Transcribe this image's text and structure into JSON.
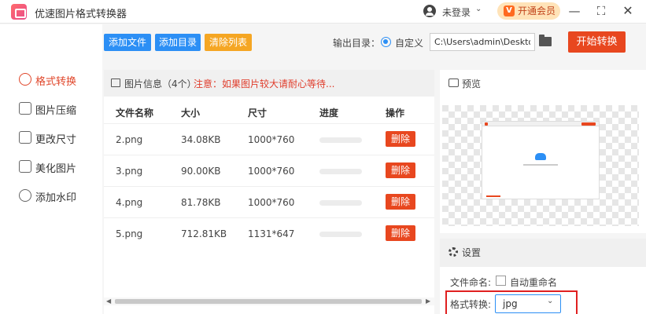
{
  "app": {
    "title": "优速图片格式转换器",
    "login": "未登录",
    "vip": "开通会员",
    "vip_icon": "V",
    "minimize": "—",
    "maximize": "⛶",
    "close": "✕"
  },
  "sidebar": {
    "items": [
      {
        "label": "格式转换",
        "icon": "format-convert-icon"
      },
      {
        "label": "图片压缩",
        "icon": "compress-icon"
      },
      {
        "label": "更改尺寸",
        "icon": "resize-icon"
      },
      {
        "label": "美化图片",
        "icon": "beautify-icon"
      },
      {
        "label": "添加水印",
        "icon": "watermark-icon"
      }
    ]
  },
  "toolbar": {
    "add_file": "添加文件",
    "add_dir": "添加目录",
    "clear_list": "清除列表",
    "output_dir_label": "输出目录：",
    "custom_label": "自定义",
    "output_path": "C:\\Users\\admin\\Desktop",
    "start": "开始转换"
  },
  "file_list": {
    "info_label": "图片信息（4个）",
    "info_warning": "注意：如果图片较大请耐心等待...",
    "columns": [
      "文件名称",
      "大小",
      "尺寸",
      "进度",
      "操作"
    ],
    "rows": [
      {
        "name": "2.png",
        "size": "34.08KB",
        "dims": "1000*760",
        "progress": 0,
        "action": "删除"
      },
      {
        "name": "3.png",
        "size": "90.00KB",
        "dims": "1000*760",
        "progress": 0,
        "action": "删除"
      },
      {
        "name": "4.png",
        "size": "81.78KB",
        "dims": "1000*760",
        "progress": 0,
        "action": "删除"
      },
      {
        "name": "5.png",
        "size": "712.81KB",
        "dims": "1131*647",
        "progress": 0,
        "action": "删除"
      }
    ]
  },
  "preview": {
    "label": "预览"
  },
  "settings": {
    "label": "设置",
    "rename_label": "文件命名:",
    "auto_rename": "自动重命名",
    "auto_rename_checked": false,
    "format_label": "格式转换:",
    "format_value": "jpg"
  },
  "colors": {
    "accent_blue": "#2c8ff5",
    "accent_orange": "#f5a623",
    "primary_red": "#e8471f",
    "active_red": "#e0462a",
    "highlight": "#e02020"
  }
}
